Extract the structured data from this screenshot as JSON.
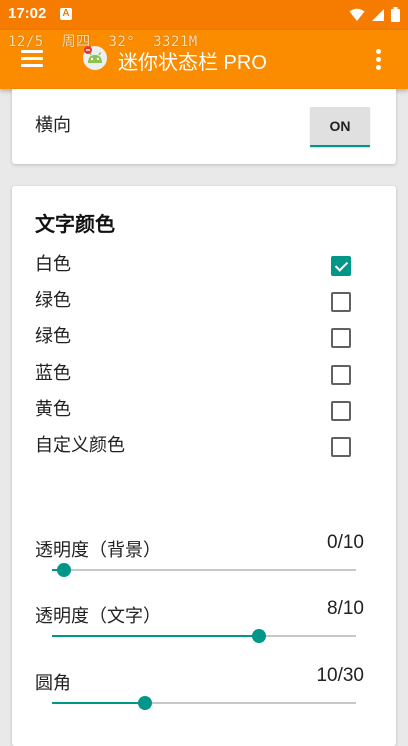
{
  "status_bar": {
    "time": "17:02",
    "notification_letter": "A"
  },
  "overlay": {
    "date": "12/5",
    "weekday": "周四",
    "temperature": "32°",
    "memory": "3321M"
  },
  "app_bar": {
    "title": "迷你状态栏 PRO"
  },
  "orientation": {
    "label": "横向",
    "toggle_label": "ON"
  },
  "text_color": {
    "title": "文字颜色",
    "options": [
      {
        "label": "白色",
        "checked": true
      },
      {
        "label": "绿色",
        "checked": false
      },
      {
        "label": "绿色",
        "checked": false
      },
      {
        "label": "蓝色",
        "checked": false
      },
      {
        "label": "黄色",
        "checked": false
      },
      {
        "label": "自定义颜色",
        "checked": false
      }
    ]
  },
  "sliders": [
    {
      "label": "透明度（背景）",
      "value_text": "0/10",
      "value": 0,
      "max": 10
    },
    {
      "label": "透明度（文字）",
      "value_text": "8/10",
      "value": 8,
      "max": 10
    },
    {
      "label": "圆角",
      "value_text": "10/30",
      "value": 10,
      "max": 30
    }
  ],
  "colors": {
    "status_bar": "#f57c00",
    "app_bar": "#fb8c00",
    "accent": "#009688"
  }
}
